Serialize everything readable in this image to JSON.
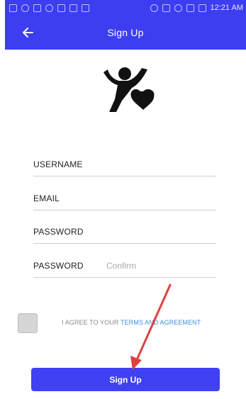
{
  "status_bar": {
    "time": "12:21 AM"
  },
  "header": {
    "title": "Sign Up"
  },
  "form": {
    "username_label": "USERNAME",
    "email_label": "EMAIL",
    "password_label": "PASSWORD",
    "confirm_label": "PASSWORD",
    "confirm_placeholder": "Confirm"
  },
  "agreement": {
    "prefix": "I AGREE TO YOUR ",
    "link": "TERMS AND AGREEMENT"
  },
  "actions": {
    "signup_label": "Sign Up"
  },
  "colors": {
    "primary": "#3d3df2",
    "link": "#3a8fe0",
    "annotation": "#e04040"
  },
  "icons": {
    "back": "arrow-left-icon",
    "logo": "person-with-heart-icon",
    "annotation": "red-arrow-icon"
  }
}
